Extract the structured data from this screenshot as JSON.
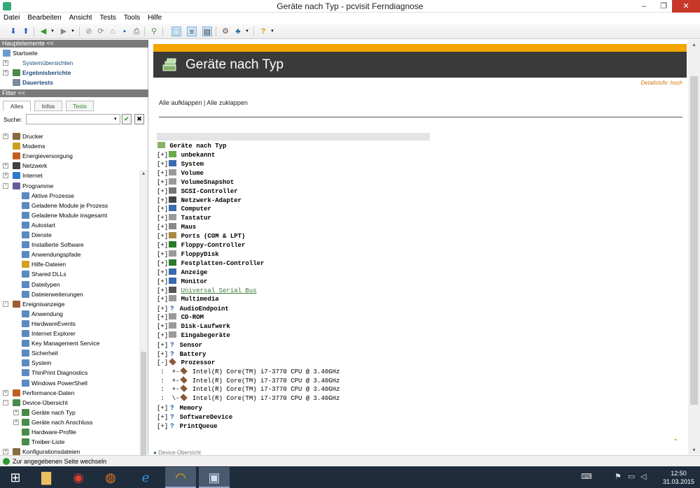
{
  "window": {
    "title": "Geräte nach Typ - pcvisit Ferndiagnose",
    "minimize": "–",
    "maximize": "❐",
    "close": "✕"
  },
  "menu": [
    "Datei",
    "Bearbeiten",
    "Ansicht",
    "Tests",
    "Tools",
    "Hilfe"
  ],
  "left": {
    "header1": "Hauptelemente <<",
    "main_items": [
      {
        "label": "Startseite",
        "bold": false
      },
      {
        "label": "Systemübersichten",
        "bold": false
      },
      {
        "label": "Ergebnisberichte",
        "bold": true
      },
      {
        "label": "Dauertests",
        "bold": true
      }
    ],
    "header2": "Filter <<",
    "tabs": [
      "Alles",
      "Infos",
      "Tests"
    ],
    "search_label": "Suche:",
    "search_value": "",
    "tree": [
      {
        "label": "Drucker",
        "level": 0,
        "exp": "+",
        "color": "#8a6a40"
      },
      {
        "label": "Modems",
        "level": 0,
        "exp": "",
        "color": "#c8a020"
      },
      {
        "label": "Energieversorgung",
        "level": 0,
        "exp": "",
        "color": "#c06020"
      },
      {
        "label": "Netzwerk",
        "level": 0,
        "exp": "+",
        "color": "#404040"
      },
      {
        "label": "Internet",
        "level": 0,
        "exp": "+",
        "color": "#2a7acc"
      },
      {
        "label": "Programme",
        "level": 0,
        "exp": "-",
        "color": "#6a5a9a"
      },
      {
        "label": "Aktive Prozesse",
        "level": 1,
        "exp": "",
        "color": "#5a8ac0"
      },
      {
        "label": "Geladene Module je Prozess",
        "level": 1,
        "exp": "",
        "color": "#5a8ac0"
      },
      {
        "label": "Geladene Module insgesamt",
        "level": 1,
        "exp": "",
        "color": "#5a8ac0"
      },
      {
        "label": "Autostart",
        "level": 1,
        "exp": "",
        "color": "#5a8ac0"
      },
      {
        "label": "Dienste",
        "level": 1,
        "exp": "",
        "color": "#5a8ac0"
      },
      {
        "label": "Installierte Software",
        "level": 1,
        "exp": "",
        "color": "#5a8ac0"
      },
      {
        "label": "Anwendungspfade",
        "level": 1,
        "exp": "",
        "color": "#5a8ac0"
      },
      {
        "label": "Hilfe-Dateien",
        "level": 1,
        "exp": "",
        "color": "#d0a020"
      },
      {
        "label": "Shared DLLs",
        "level": 1,
        "exp": "",
        "color": "#5a8ac0"
      },
      {
        "label": "Dateitypen",
        "level": 1,
        "exp": "",
        "color": "#5a8ac0"
      },
      {
        "label": "Dateierweiterungen",
        "level": 1,
        "exp": "",
        "color": "#5a8ac0"
      },
      {
        "label": "Ereignisanzeige",
        "level": 0,
        "exp": "-",
        "color": "#a05a30"
      },
      {
        "label": "Anwendung",
        "level": 1,
        "exp": "",
        "color": "#5a8ac0"
      },
      {
        "label": "HardwareEvents",
        "level": 1,
        "exp": "",
        "color": "#5a8ac0"
      },
      {
        "label": "Internet Explorer",
        "level": 1,
        "exp": "",
        "color": "#5a8ac0"
      },
      {
        "label": "Key Management Service",
        "level": 1,
        "exp": "",
        "color": "#5a8ac0"
      },
      {
        "label": "Sicherheit",
        "level": 1,
        "exp": "",
        "color": "#5a8ac0"
      },
      {
        "label": "System",
        "level": 1,
        "exp": "",
        "color": "#5a8ac0"
      },
      {
        "label": "ThinPrint Diagnostics",
        "level": 1,
        "exp": "",
        "color": "#5a8ac0"
      },
      {
        "label": "Windows PowerShell",
        "level": 1,
        "exp": "",
        "color": "#5a8ac0"
      },
      {
        "label": "Performance-Daten",
        "level": 0,
        "exp": "+",
        "color": "#c06020"
      },
      {
        "label": "Device-Übersicht",
        "level": 0,
        "exp": "-",
        "color": "#4a8a4a"
      },
      {
        "label": "Geräte nach Typ",
        "level": 1,
        "exp": "+",
        "color": "#4a8a4a"
      },
      {
        "label": "Geräte nach Anschluss",
        "level": 1,
        "exp": "+",
        "color": "#4a8a4a"
      },
      {
        "label": "Hardware-Profile",
        "level": 1,
        "exp": "",
        "color": "#4a8a4a"
      },
      {
        "label": "Treiber-Liste",
        "level": 1,
        "exp": "",
        "color": "#4a8a4a"
      },
      {
        "label": "Konfigurationsdateien",
        "level": 0,
        "exp": "+",
        "color": "#8a6a40"
      }
    ]
  },
  "main": {
    "title": "Geräte nach Typ",
    "detail": "Detailstufe: hoch",
    "expand_all": "Alle aufklappen",
    "separator": " | ",
    "collapse_all": "Alle zuklappen",
    "root": "Geräte nach Typ",
    "devices": [
      {
        "exp": "[+]",
        "label": "unbekannt",
        "icon": "green",
        "link": false
      },
      {
        "exp": "[+]",
        "label": "System",
        "icon": "blue",
        "link": false
      },
      {
        "exp": "[+]",
        "label": "Volume",
        "icon": "grey",
        "link": false
      },
      {
        "exp": "[+]",
        "label": "VolumeSnapshot",
        "icon": "grey",
        "link": false
      },
      {
        "exp": "[+]",
        "label": "SCSI-Controller",
        "icon": "arrow",
        "link": false
      },
      {
        "exp": "[+]",
        "label": "Netzwerk-Adapter",
        "icon": "net",
        "link": false
      },
      {
        "exp": "[+]",
        "label": "Computer",
        "icon": "blue",
        "link": false
      },
      {
        "exp": "[+]",
        "label": "Tastatur",
        "icon": "grey",
        "link": false
      },
      {
        "exp": "[+]",
        "label": "Maus",
        "icon": "mouse",
        "link": false
      },
      {
        "exp": "[+]",
        "label": "Ports (COM & LPT)",
        "icon": "port",
        "link": false
      },
      {
        "exp": "[+]",
        "label": "Floppy-Controller",
        "icon": "chip",
        "link": false
      },
      {
        "exp": "[+]",
        "label": "FloppyDisk",
        "icon": "grey",
        "link": false
      },
      {
        "exp": "[+]",
        "label": "Festplatten-Controller",
        "icon": "chip",
        "link": false
      },
      {
        "exp": "[+]",
        "label": "Anzeige",
        "icon": "blue",
        "link": false
      },
      {
        "exp": "[+]",
        "label": "Monitor",
        "icon": "blue",
        "link": false
      },
      {
        "exp": "[+]",
        "label": "Universal Serial Bus",
        "icon": "usb",
        "link": true
      },
      {
        "exp": "[+]",
        "label": "Multimedia",
        "icon": "grey",
        "link": false
      },
      {
        "exp": "[+]",
        "label": "AudioEndpoint",
        "icon": "q",
        "link": false
      },
      {
        "exp": "[+]",
        "label": "CD-ROM",
        "icon": "grey",
        "link": false
      },
      {
        "exp": "[+]",
        "label": "Disk-Laufwerk",
        "icon": "grey",
        "link": false
      },
      {
        "exp": "[+]",
        "label": "Eingabegeräte",
        "icon": "grey",
        "link": false
      },
      {
        "exp": "[+]",
        "label": "Sensor",
        "icon": "q",
        "link": false
      },
      {
        "exp": "[+]",
        "label": "Battery",
        "icon": "q",
        "link": false
      },
      {
        "exp": "[-]",
        "label": "Prozessor",
        "icon": "cpu",
        "link": false
      },
      {
        "exp": " :  +-",
        "label": "Intel(R) Core(TM) i7-3770 CPU @ 3.40GHz",
        "icon": "cpu",
        "link": false
      },
      {
        "exp": " :  +-",
        "label": "Intel(R) Core(TM) i7-3770 CPU @ 3.40GHz",
        "icon": "cpu",
        "link": false
      },
      {
        "exp": " :  +-",
        "label": "Intel(R) Core(TM) i7-3770 CPU @ 3.40GHz",
        "icon": "cpu",
        "link": false
      },
      {
        "exp": " :  \\-",
        "label": "Intel(R) Core(TM) i7-3770 CPU @ 3.40GHz",
        "icon": "cpu",
        "link": false
      },
      {
        "exp": "[+]",
        "label": "Memory",
        "icon": "q",
        "link": false
      },
      {
        "exp": "[+]",
        "label": "SoftwareDevice",
        "icon": "q",
        "link": false
      },
      {
        "exp": "[+]",
        "label": "PrintQueue",
        "icon": "q",
        "link": false
      }
    ],
    "cutoff": "Device-Übersicht"
  },
  "status": "Zur angegebenen Seite wechseln",
  "taskbar": {
    "time": "12:50",
    "date": "31.03.2015"
  },
  "colors": {
    "accent": "#f5a300",
    "banner": "#3a3a3a",
    "link": "#3a7a3a",
    "detail": "#d07a10"
  }
}
